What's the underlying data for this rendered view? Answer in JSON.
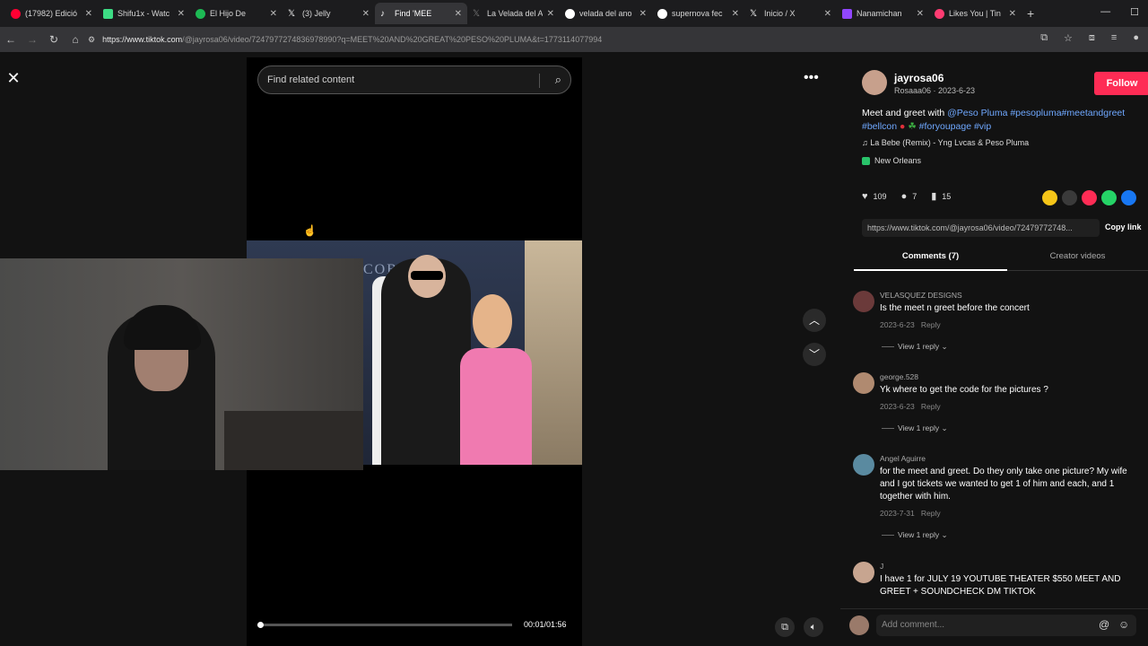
{
  "browser": {
    "tabs": [
      {
        "title": "(17982) Edició",
        "color": "#ff0033"
      },
      {
        "title": "Shifu1x - Watc",
        "color": "#3ddc84"
      },
      {
        "title": "El Hijo De",
        "color": "#1db954"
      },
      {
        "title": "(3) Jelly",
        "color": "#ffffff"
      },
      {
        "title": "Find 'MEE",
        "color": "#ffffff"
      },
      {
        "title": "La Velada del A",
        "color": "#444444"
      },
      {
        "title": "velada del ano",
        "color": "#4285f4"
      },
      {
        "title": "supernova fec",
        "color": "#4285f4"
      },
      {
        "title": "Inicio / X",
        "color": "#ffffff"
      },
      {
        "title": "Nanamichan",
        "color": "#9146ff"
      },
      {
        "title": "Likes You | Tin",
        "color": "#fe3c72"
      }
    ],
    "url_host": "https://www.tiktok.com",
    "url_path": "/@jayrosa06/video/7247977274836978990?q=MEET%20AND%20GREAT%20PESO%20PLUMA&t=1773114077994"
  },
  "video": {
    "search_placeholder": "Find related content",
    "time": "00:01/01:56",
    "progress": 0.01
  },
  "post": {
    "username": "jayrosa06",
    "subline": "Rosaaa06 · 2023-6-23",
    "follow": "Follow",
    "desc_text": "Meet and greet with",
    "desc_mention": "@Peso Pluma",
    "desc_tags": "#pesopluma#meetandgreet",
    "desc_line2": "#bellcon",
    "desc_line2b": "#foryoupage #vip",
    "music": "♫  La Bebe (Remix) - Yng Lvcas & Peso Pluma",
    "location": "New Orleans",
    "likes": "109",
    "comments": "7",
    "saves": "15",
    "link": "https://www.tiktok.com/@jayrosa06/video/72479772748...",
    "copy": "Copy link",
    "tab_comments": "Comments (7)",
    "tab_creator": "Creator videos"
  },
  "comments": [
    {
      "name": "VELASQUEZ DESIGNS",
      "text": "Is the meet n greet before the concert",
      "date": "2023-6-23",
      "reply": "Reply",
      "view": "View 1 reply"
    },
    {
      "name": "george.528",
      "text": "Yk where to get the code for the pictures ?",
      "date": "2023-6-23",
      "reply": "Reply",
      "view": "View 1 reply"
    },
    {
      "name": "Angel Aguirre",
      "text": "for the meet and greet. Do they only take one picture? My wife and I got tickets we wanted to get 1 of him and each, and 1 together with him.",
      "date": "2023-7-31",
      "reply": "Reply",
      "view": "View 1 reply"
    },
    {
      "name": "J",
      "text": "I have 1 for JULY 19 YOUTUBE THEATER $550 MEET AND GREET + SOUNDCHECK DM TIKTOK",
      "date": "",
      "reply": "",
      "view": ""
    }
  ],
  "add_comment": "Add comment..."
}
